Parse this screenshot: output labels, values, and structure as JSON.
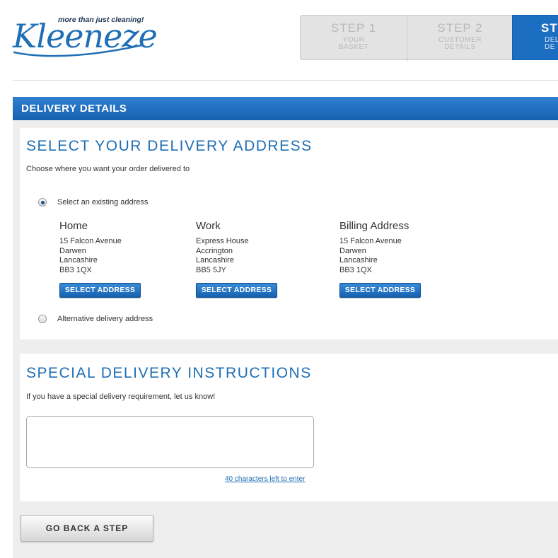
{
  "brand": {
    "logo_text": "Kleeneze",
    "tagline": "more than just cleaning!",
    "logo_color": "#1e6fb5"
  },
  "steps": [
    {
      "title": "STEP 1",
      "subtitle": "YOUR BASKET",
      "active": false
    },
    {
      "title": "STEP 2",
      "subtitle": "CUSTOMER DETAILS",
      "active": false
    },
    {
      "title": "ST",
      "subtitle": "DEL DE",
      "active": true
    }
  ],
  "panel": {
    "title": "DELIVERY DETAILS",
    "accent_color": "#1b6ec2"
  },
  "address_section": {
    "title": "SELECT YOUR DELIVERY ADDRESS",
    "description": "Choose where you want your order delivered to",
    "option_existing": "Select an existing address",
    "option_alternative": "Alternative delivery address",
    "selected_option": "existing",
    "addresses": [
      {
        "name": "Home",
        "lines": [
          "15 Falcon Avenue",
          "Darwen",
          "Lancashire",
          "BB3 1QX"
        ],
        "button": "SELECT ADDRESS"
      },
      {
        "name": "Work",
        "lines": [
          "Express House",
          "Accrington",
          "Lancashire",
          "BB5 5JY"
        ],
        "button": "SELECT ADDRESS"
      },
      {
        "name": "Billing Address",
        "lines": [
          "15 Falcon Avenue",
          "Darwen",
          "Lancashire",
          "BB3 1QX"
        ],
        "button": "SELECT ADDRESS"
      }
    ]
  },
  "special_section": {
    "title": "SPECIAL DELIVERY INSTRUCTIONS",
    "description": "If you have a special delivery requirement, let us know!",
    "textarea_value": "",
    "chars_left": "40 characters left to enter"
  },
  "footer": {
    "back_button": "GO BACK A STEP"
  }
}
